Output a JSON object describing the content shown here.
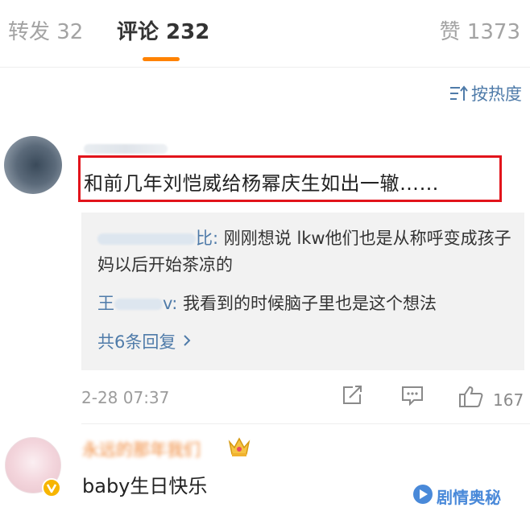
{
  "tabs": {
    "repost": "转发 32",
    "comment": "评论 232",
    "like": "赞 1373"
  },
  "sort": {
    "label": "按热度"
  },
  "comments": [
    {
      "text": "和前几年刘恺威给杨幂庆生如出一辙……",
      "replies": [
        {
          "name_visible": "比:",
          "text": "刚刚想说 lkw他们也是从称呼变成孩子妈以后开始茶凉的"
        },
        {
          "name_visible_start": "王",
          "name_visible_end": "v:",
          "text": "我看到的时候脑子里也是这个想法"
        }
      ],
      "more_replies": "共6条回复",
      "time": "2-28 07:37",
      "likes": "167"
    },
    {
      "name": "永远的那年我们",
      "text": "baby生日快乐"
    }
  ],
  "watermark": "剧情奥秘",
  "colors": {
    "accent": "#ff8200",
    "link": "#4f7ba9",
    "highlight_box": "#e2141b",
    "name_orange": "#f08a3c"
  }
}
